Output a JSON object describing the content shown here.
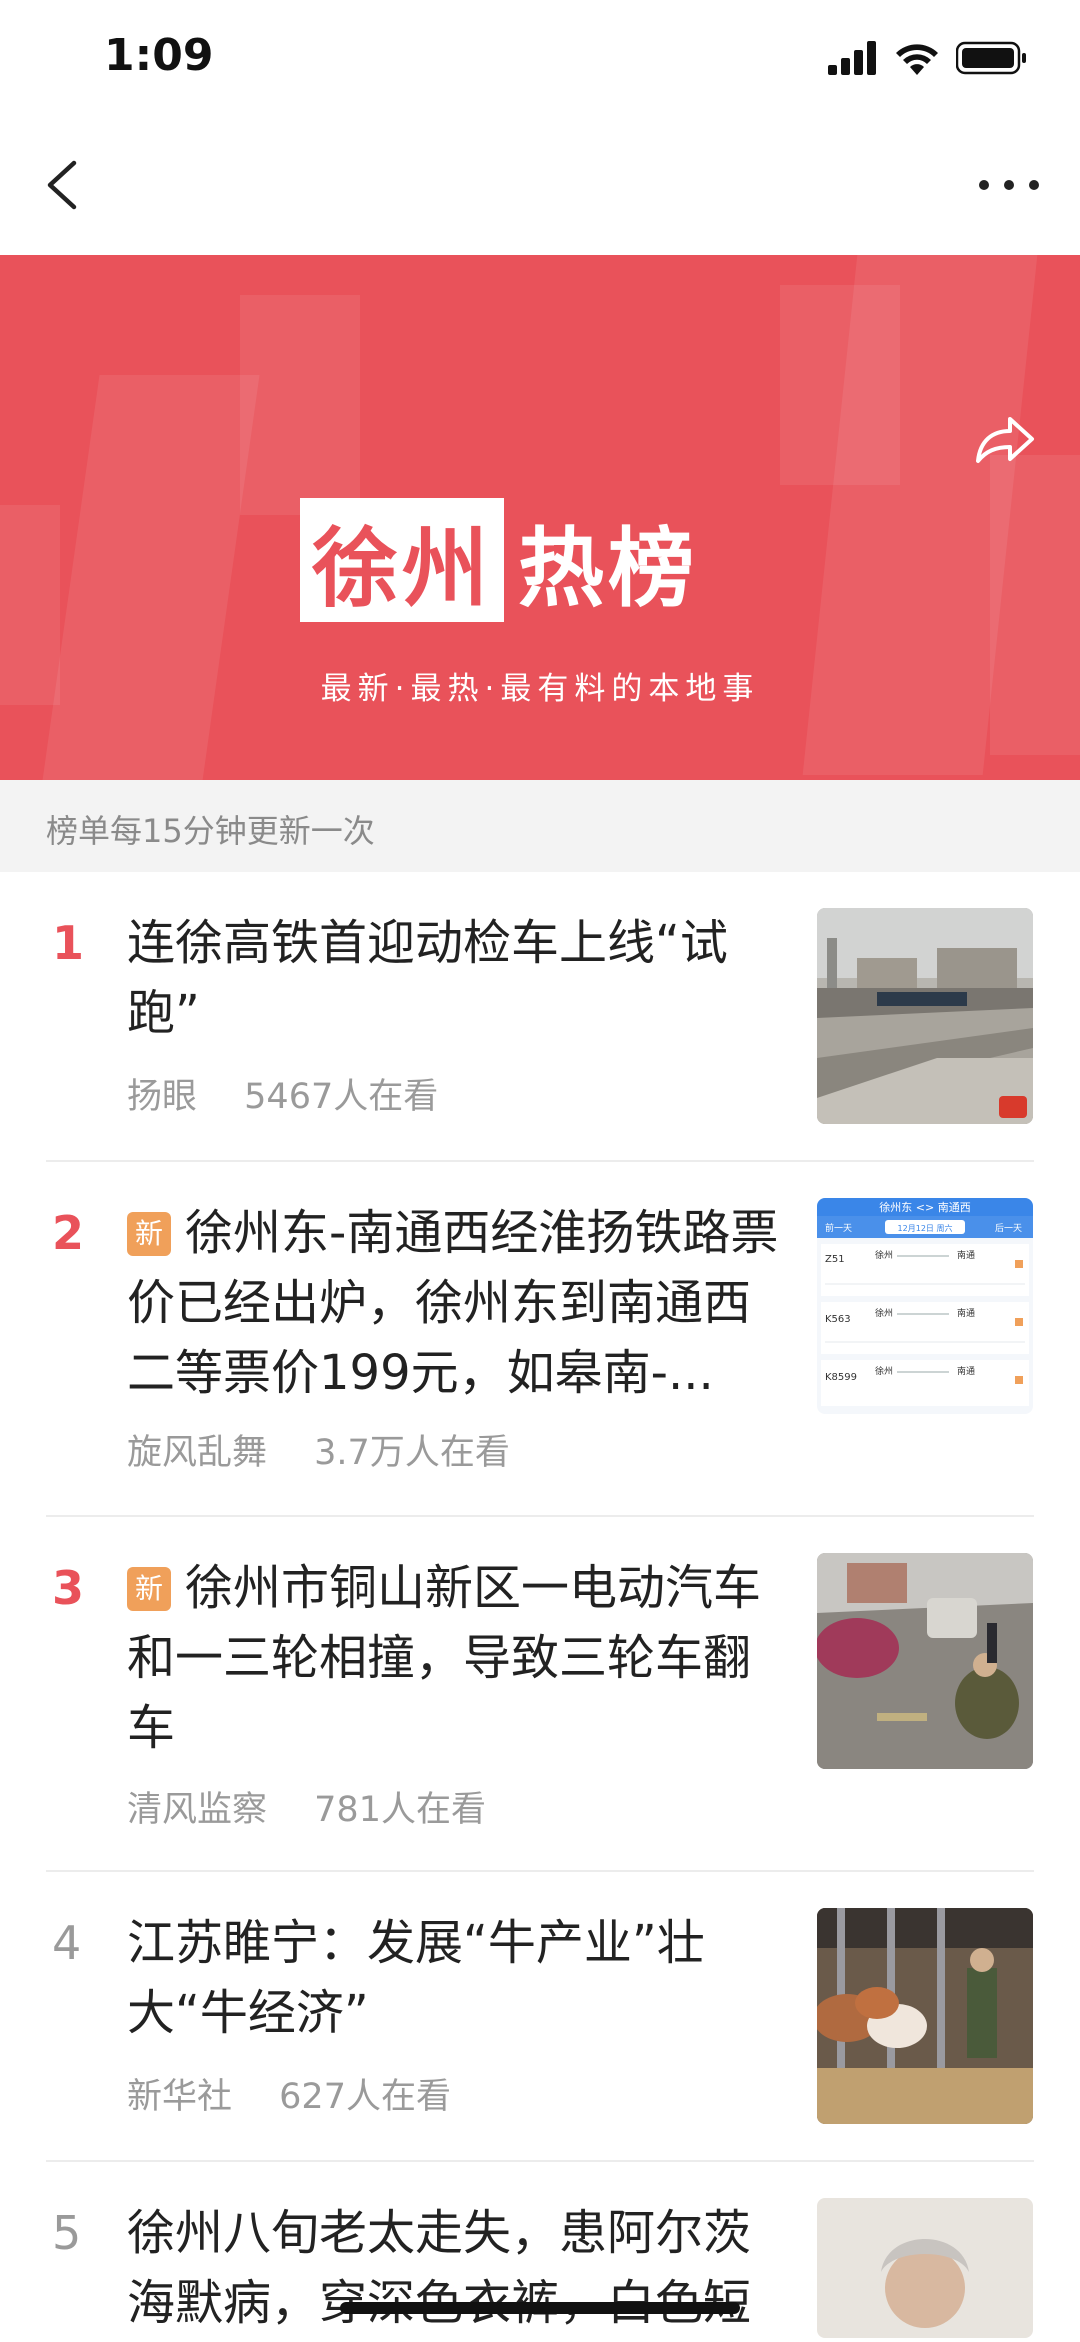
{
  "status_bar": {
    "time": "1:09"
  },
  "nav": {
    "back_icon": "chevron-left-icon",
    "more_icon": "more-dots-icon"
  },
  "banner": {
    "title_boxed": "徐州",
    "title_plain": "热榜",
    "subtitle": "最新·最热·最有料的本地事",
    "share_icon": "share-icon",
    "bg_color": "#e9525a"
  },
  "info_strip": {
    "text": "榜单每15分钟更新一次"
  },
  "news": [
    {
      "rank": "1",
      "badge": "",
      "title": "连徐高铁首迎动检车上线“试跑”",
      "source": "扬眼",
      "viewers": "5467人在看"
    },
    {
      "rank": "2",
      "badge": "新",
      "title": "徐州东-南通西经淮扬铁路票价已经出炉，徐州东到南通西二等票价199元，如皋南-...",
      "source": "旋风乱舞",
      "viewers": "3.7万人在看"
    },
    {
      "rank": "3",
      "badge": "新",
      "title": "徐州市铜山新区一电动汽车和一三轮相撞，导致三轮车翻车",
      "source": "清风监察",
      "viewers": "781人在看"
    },
    {
      "rank": "4",
      "badge": "",
      "title": "江苏睢宁：发展“牛产业”壮大“牛经济”",
      "source": "新华社",
      "viewers": "627人在看"
    },
    {
      "rank": "5",
      "badge": "",
      "title": "徐州八旬老太走失，患阿尔茨海默病，穿深色衣裤，白色短",
      "source": "",
      "viewers": ""
    }
  ],
  "thumb2_labels": {
    "header": "徐州东 <> 南通西",
    "prev": "前一天",
    "next": "后一天",
    "date": "12月12日 周六",
    "trains": [
      "Z51",
      "K563",
      "K8599"
    ],
    "from": "徐州",
    "to": "南通"
  },
  "colors": {
    "accent": "#e9525a",
    "badge": "#f0a05a",
    "muted": "#9a9a9a"
  }
}
